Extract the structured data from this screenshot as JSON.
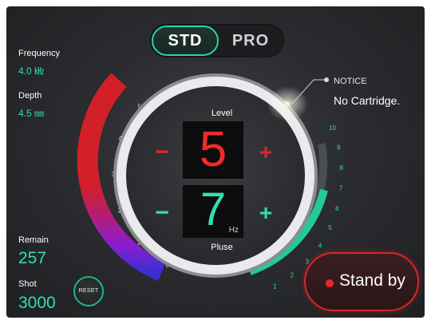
{
  "mode_toggle": {
    "std_label": "STD",
    "pro_label": "PRO",
    "selected": "STD"
  },
  "info": {
    "frequency_label": "Frequency",
    "frequency_value": "4.0 ㎑",
    "depth_label": "Depth",
    "depth_value": "4.5 ㎜",
    "remain_label": "Remain",
    "remain_value": "257",
    "shot_label": "Shot",
    "shot_value": "3000"
  },
  "reset_label": "RESET",
  "notice": {
    "label": "NOTICE",
    "text": "No Cartridge."
  },
  "level": {
    "label": "Level",
    "value": "5",
    "minus": "−",
    "plus": "+"
  },
  "pulse": {
    "label": "Pluse",
    "value": "7",
    "unit": "Hz",
    "minus": "−",
    "plus": "+"
  },
  "level_gauge": {
    "ticks": [
      "0",
      "1",
      "2",
      "3",
      "4",
      "5"
    ],
    "level": 5
  },
  "pulse_gauge": {
    "ticks": [
      "1",
      "2",
      "3",
      "4",
      "5",
      "6",
      "7",
      "8",
      "9",
      "10"
    ],
    "level": 7
  },
  "standby": {
    "label": "Stand by"
  },
  "colors": {
    "accent_green": "#2ee0b0",
    "accent_red": "#e3272b",
    "level_gauge_low": "#3a2fd0",
    "level_gauge_mid": "#a020c0"
  }
}
